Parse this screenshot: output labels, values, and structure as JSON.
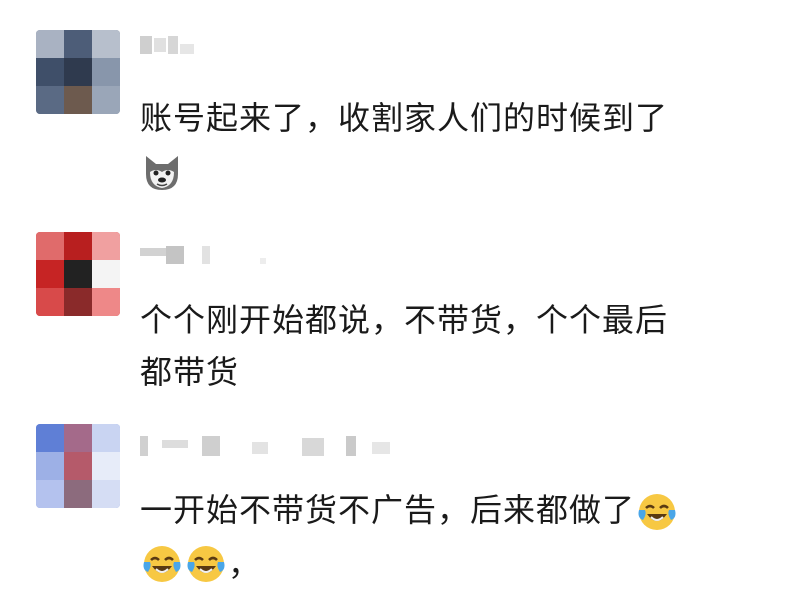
{
  "comments": [
    {
      "username": "",
      "text_line_1": "账号起来了，收割家人们的时候到了",
      "emoji": "husky-dog-face-icon"
    },
    {
      "username": "",
      "text_line_1": "个个刚开始都说，不带货，个个最后",
      "text_line_2": "都带货"
    },
    {
      "username": "",
      "text_line_1": "一开始不带货不广告，后来都做了",
      "emoji_inline": "tears-of-joy-icon",
      "emoji_line_2": [
        "tears-of-joy-icon",
        "tears-of-joy-icon"
      ],
      "text_line_2_tail": "，"
    }
  ],
  "colors": {
    "text": "#1a1a1a",
    "background": "#ffffff",
    "mosaic_gray": "#c8c8c8",
    "avatar_1_main": "#5b6b86",
    "avatar_2_main": "#d32b2b",
    "avatar_3_main": "#5f7fd6"
  }
}
